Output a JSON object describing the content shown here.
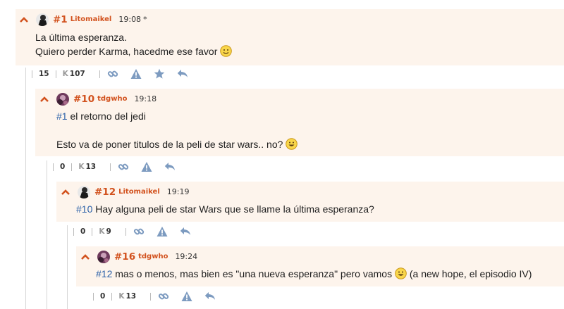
{
  "colors": {
    "accent": "#d2521e",
    "link": "#2c61a8",
    "comment_bg": "#fdf4ec",
    "icon_blue": "#7d9bc0"
  },
  "comments": [
    {
      "number": "#1",
      "user": "Litomaikel",
      "time": "19:08",
      "edited_mark": "*",
      "lines": [
        "La última esperanza.",
        "Quiero perder Karma, hacedme ese favor"
      ],
      "votes": "15",
      "karma_prefix": "K",
      "karma": "107",
      "icons": [
        "link-icon",
        "report-icon",
        "favorite-star-icon",
        "reply-icon"
      ]
    },
    {
      "number": "#10",
      "user": "tdgwho",
      "time": "19:18",
      "ref": "#1",
      "lines": [
        "el retorno del jedi",
        "Esto va de poner titulos de la peli de star wars.. no?"
      ],
      "votes": "0",
      "karma_prefix": "K",
      "karma": "13",
      "icons": [
        "link-icon",
        "report-icon",
        "reply-icon"
      ]
    },
    {
      "number": "#12",
      "user": "Litomaikel",
      "time": "19:19",
      "ref": "#10",
      "lines": [
        "Hay alguna peli de star Wars que se llame la última esperanza?"
      ],
      "votes": "0",
      "karma_prefix": "K",
      "karma": "9",
      "icons": [
        "link-icon",
        "report-icon",
        "reply-icon"
      ]
    },
    {
      "number": "#16",
      "user": "tdgwho",
      "time": "19:24",
      "ref": "#12",
      "lines": [
        "mas o menos, mas bien es \"una nueva esperanza\" pero vamos",
        "(a new hope, el episodio IV)"
      ],
      "votes": "0",
      "karma_prefix": "K",
      "karma": "13",
      "icons": [
        "link-icon",
        "report-icon",
        "reply-icon"
      ]
    }
  ]
}
